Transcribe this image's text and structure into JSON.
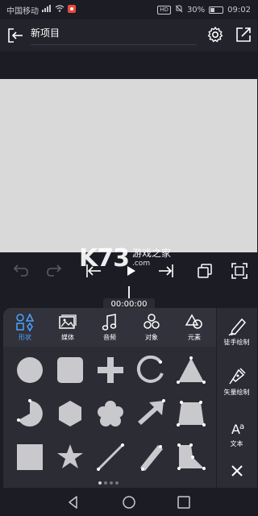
{
  "status_bar": {
    "carrier": "中国移动",
    "signal": "⁴⁶",
    "hd": "HD",
    "battery": "30%",
    "time": "09:02"
  },
  "header": {
    "title": "新项目",
    "back_icon": "back-arrow-icon",
    "settings_icon": "gear-icon",
    "export_icon": "export-icon"
  },
  "watermark": {
    "logo": "K73",
    "text": "游戏之家",
    "url": ".com"
  },
  "timeline": {
    "timecode": "00:00:00"
  },
  "tabs": [
    {
      "label": "形状",
      "icon": "shapes-icon",
      "active": true
    },
    {
      "label": "媒体",
      "icon": "media-icon",
      "active": false
    },
    {
      "label": "音频",
      "icon": "music-icon",
      "active": false
    },
    {
      "label": "对象",
      "icon": "objects-icon",
      "active": false
    },
    {
      "label": "元素",
      "icon": "elements-icon",
      "active": false
    }
  ],
  "sidebar": {
    "freehand_label": "徒手绘制",
    "vector_label": "矢量绘制",
    "text_label": "文本",
    "close_icon": "close-icon"
  },
  "shapes": [
    "circle",
    "rounded-square",
    "plus",
    "arc",
    "triangle",
    "pie",
    "hexagon",
    "flower",
    "arrow",
    "quad",
    "square",
    "star",
    "line",
    "pill",
    "polygon"
  ],
  "pagination": {
    "pages": 4,
    "current": 1
  },
  "colors": {
    "accent": "#4da3ff",
    "shape_fill": "#c8c8cd",
    "panel": "#2b2c34",
    "canvas": "#d9d9d9"
  }
}
